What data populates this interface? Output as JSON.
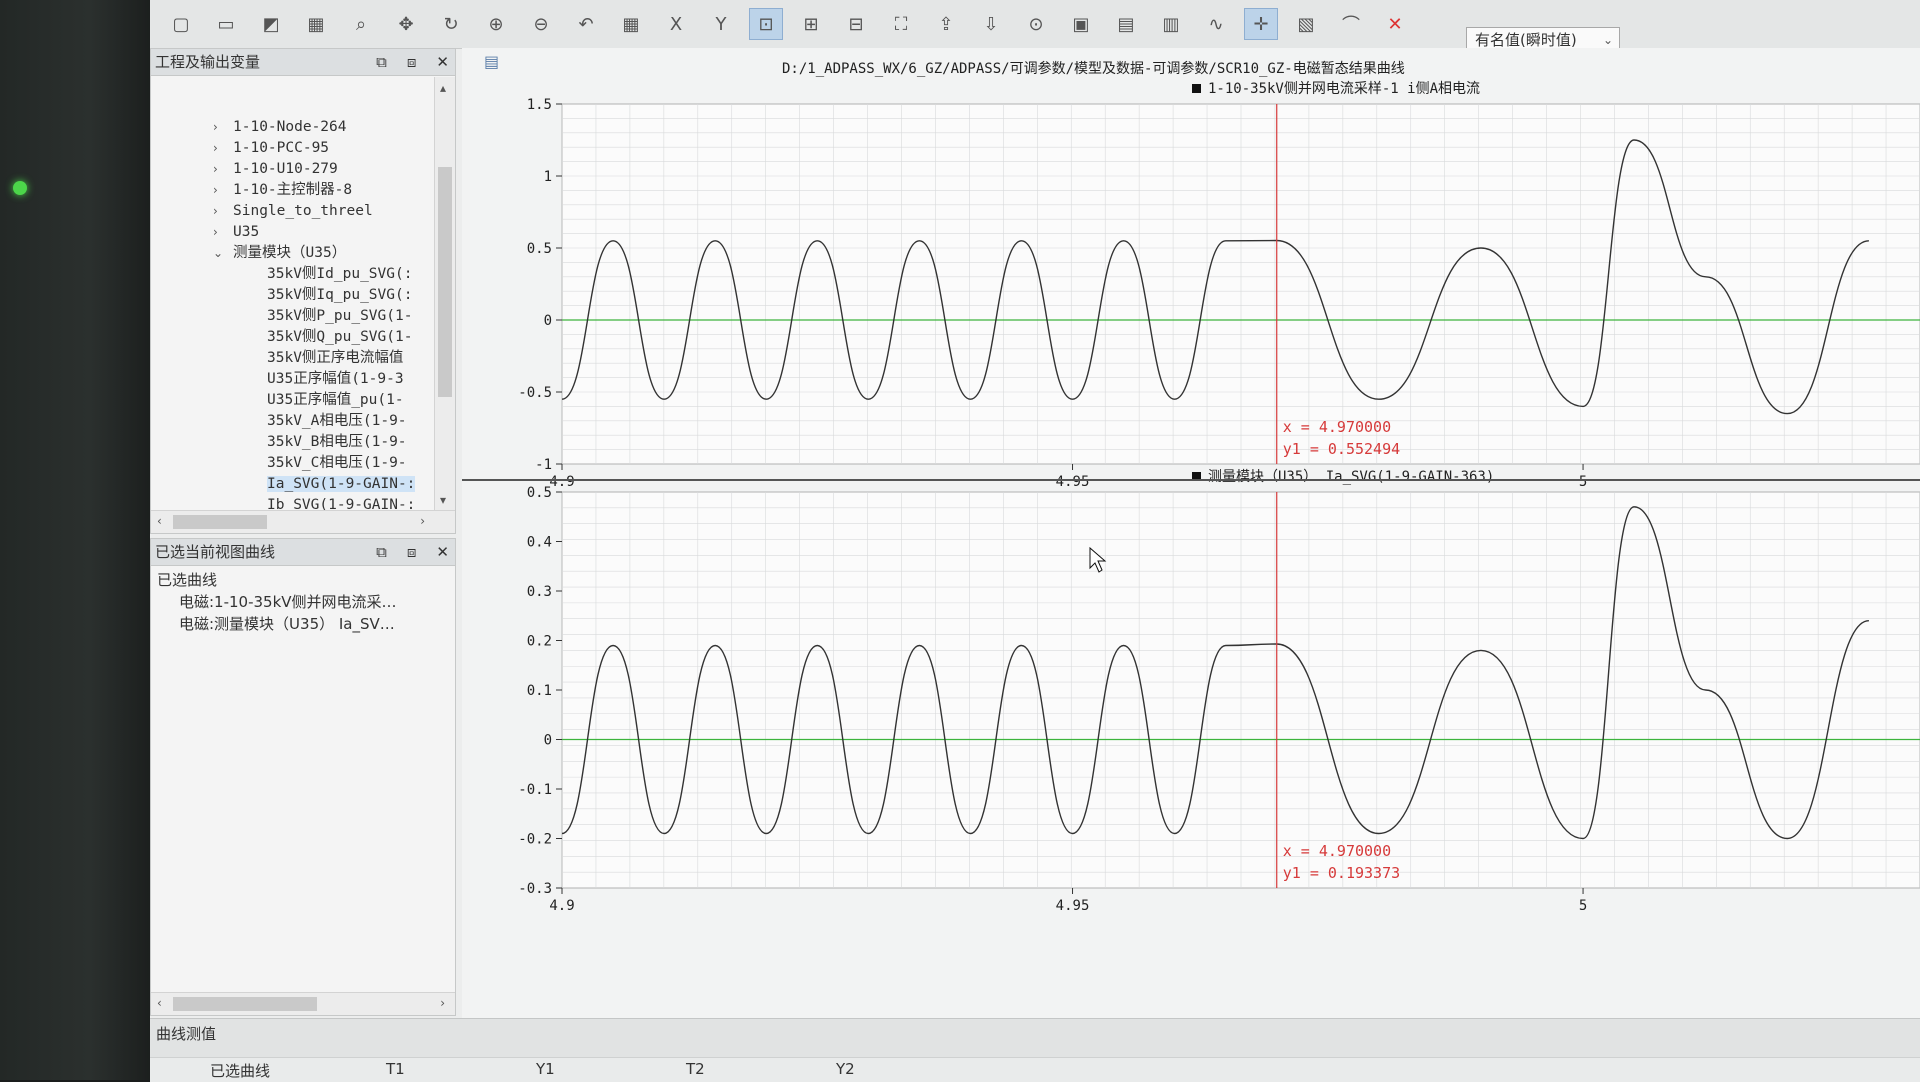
{
  "toolbar": {
    "icons": [
      "new-icon",
      "open-icon",
      "save-icon",
      "print-icon",
      "search-icon",
      "pan-icon",
      "rotate-icon",
      "zoom-in-icon",
      "zoom-out-icon",
      "undo-icon",
      "grid-icon",
      "x-axis-icon",
      "y-axis-icon",
      "zoom-region-icon",
      "zoom-x-icon",
      "zoom-y-icon",
      "fit-icon",
      "export-up-icon",
      "import-down-icon",
      "zoom-icon",
      "max-icon",
      "abs-icon",
      "table-icon",
      "fft-icon",
      "crosshair-icon",
      "calc-icon",
      "curve-icon",
      "delete-icon"
    ],
    "value_mode": "有名值(瞬时值)"
  },
  "project_panel": {
    "title": "工程及输出变量",
    "items": [
      {
        "label": "1-10-Node-264",
        "level": 1,
        "expanded": false
      },
      {
        "label": "1-10-PCC-95",
        "level": 1,
        "expanded": false
      },
      {
        "label": "1-10-U10-279",
        "level": 1,
        "expanded": false
      },
      {
        "label": "1-10-主控制器-8",
        "level": 1,
        "expanded": false
      },
      {
        "label": "Single_to_threel",
        "level": 1,
        "expanded": false
      },
      {
        "label": "U35",
        "level": 1,
        "expanded": false
      },
      {
        "label": "测量模块（U35）",
        "level": 1,
        "expanded": true
      },
      {
        "label": "35kV侧Id_pu_SVG(:",
        "level": 2
      },
      {
        "label": "35kV侧Iq_pu_SVG(:",
        "level": 2
      },
      {
        "label": "35kV侧P_pu_SVG(1-",
        "level": 2
      },
      {
        "label": "35kV侧Q_pu_SVG(1-",
        "level": 2
      },
      {
        "label": "35kV侧正序电流幅值",
        "level": 2
      },
      {
        "label": "U35正序幅值(1-9-3",
        "level": 2
      },
      {
        "label": "U35正序幅值_pu(1-",
        "level": 2
      },
      {
        "label": "35kV_A相电压(1-9-",
        "level": 2
      },
      {
        "label": "35kV_B相电压(1-9-",
        "level": 2
      },
      {
        "label": "35kV_C相电压(1-9-",
        "level": 2
      },
      {
        "label": "Ia_SVG(1-9-GAIN-:",
        "level": 2,
        "selected": true
      },
      {
        "label": "Ib SVG(1-9-GAIN-:",
        "level": 2
      }
    ]
  },
  "selected_panel": {
    "title": "已选当前视图曲线",
    "header": "已选曲线",
    "items": [
      "电磁:1-10-35kV侧并网电流采…",
      "电磁:测量模块（U35） Ia_SV…"
    ]
  },
  "file_path": "D:/1_ADPASS_WX/6_GZ/ADPASS/可调参数/模型及数据-可调参数/SCR10_GZ-电磁暂态结果曲线",
  "plots": [
    {
      "legend": "1-10-35kV侧并网电流采样-1 i侧A相电流",
      "cursor": {
        "x_label": "x = 4.970000",
        "y_label": "y1 = 0.552494"
      }
    },
    {
      "legend": "测量模块（U35） Ia_SVG(1-9-GAIN-363)",
      "cursor": {
        "x_label": "x = 4.970000",
        "y_label": "y1 = 0.193373"
      }
    }
  ],
  "chart_data": [
    {
      "type": "line",
      "legend": "1-10-35kV侧并网电流采样-1 i侧A相电流",
      "xlim": [
        4.9,
        5.033
      ],
      "ylim": [
        -1,
        1.5
      ],
      "xticks": [
        "4.9",
        "4.95",
        "5"
      ],
      "yticks": [
        "1.5",
        "1",
        "0.5",
        "0",
        "-0.5",
        "-1"
      ],
      "grid": true,
      "cursor_x": 4.97,
      "cursor_y": 0.552494,
      "series": [
        {
          "color": "#333333",
          "points": [
            [
              4.9,
              -0.55
            ],
            [
              4.905,
              0.55
            ],
            [
              4.91,
              -0.55
            ],
            [
              4.915,
              0.55
            ],
            [
              4.92,
              -0.55
            ],
            [
              4.925,
              0.55
            ],
            [
              4.93,
              -0.55
            ],
            [
              4.935,
              0.55
            ],
            [
              4.94,
              -0.55
            ],
            [
              4.945,
              0.55
            ],
            [
              4.95,
              -0.55
            ],
            [
              4.955,
              0.55
            ],
            [
              4.96,
              -0.55
            ],
            [
              4.965,
              0.55
            ],
            [
              4.97,
              0.552
            ],
            [
              4.98,
              -0.55
            ],
            [
              4.99,
              0.5
            ],
            [
              5.0,
              -0.6
            ],
            [
              5.005,
              1.25
            ],
            [
              5.012,
              0.3
            ],
            [
              5.02,
              -0.65
            ],
            [
              5.028,
              0.55
            ]
          ]
        }
      ],
      "baseline": {
        "color": "#3cb43c",
        "value": 0
      }
    },
    {
      "type": "line",
      "legend": "测量模块（U35） Ia_SVG(1-9-GAIN-363)",
      "xlim": [
        4.9,
        5.033
      ],
      "ylim": [
        -0.3,
        0.5
      ],
      "xticks": [
        "4.9",
        "4.95",
        "5"
      ],
      "yticks": [
        "0.5",
        "0.4",
        "0.3",
        "0.2",
        "0.1",
        "0",
        "-0.1",
        "-0.2",
        "-0.3"
      ],
      "grid": true,
      "cursor_x": 4.97,
      "cursor_y": 0.193373,
      "series": [
        {
          "color": "#333333",
          "points": [
            [
              4.9,
              -0.19
            ],
            [
              4.905,
              0.19
            ],
            [
              4.91,
              -0.19
            ],
            [
              4.915,
              0.19
            ],
            [
              4.92,
              -0.19
            ],
            [
              4.925,
              0.19
            ],
            [
              4.93,
              -0.19
            ],
            [
              4.935,
              0.19
            ],
            [
              4.94,
              -0.19
            ],
            [
              4.945,
              0.19
            ],
            [
              4.95,
              -0.19
            ],
            [
              4.955,
              0.19
            ],
            [
              4.96,
              -0.19
            ],
            [
              4.965,
              0.19
            ],
            [
              4.97,
              0.193
            ],
            [
              4.98,
              -0.19
            ],
            [
              4.99,
              0.18
            ],
            [
              5.0,
              -0.2
            ],
            [
              5.005,
              0.47
            ],
            [
              5.012,
              0.1
            ],
            [
              5.02,
              -0.2
            ],
            [
              5.028,
              0.24
            ]
          ]
        }
      ],
      "baseline": {
        "color": "#3cb43c",
        "value": 0
      }
    }
  ],
  "bottom": {
    "title": "曲线测值",
    "columns": [
      "已选曲线",
      "T1",
      "Y1",
      "T2",
      "Y2"
    ]
  },
  "colors": {
    "cursor": "#d63a3a",
    "baseline": "#3cb43c",
    "trace": "#333333",
    "grid": "#d8dadb"
  }
}
